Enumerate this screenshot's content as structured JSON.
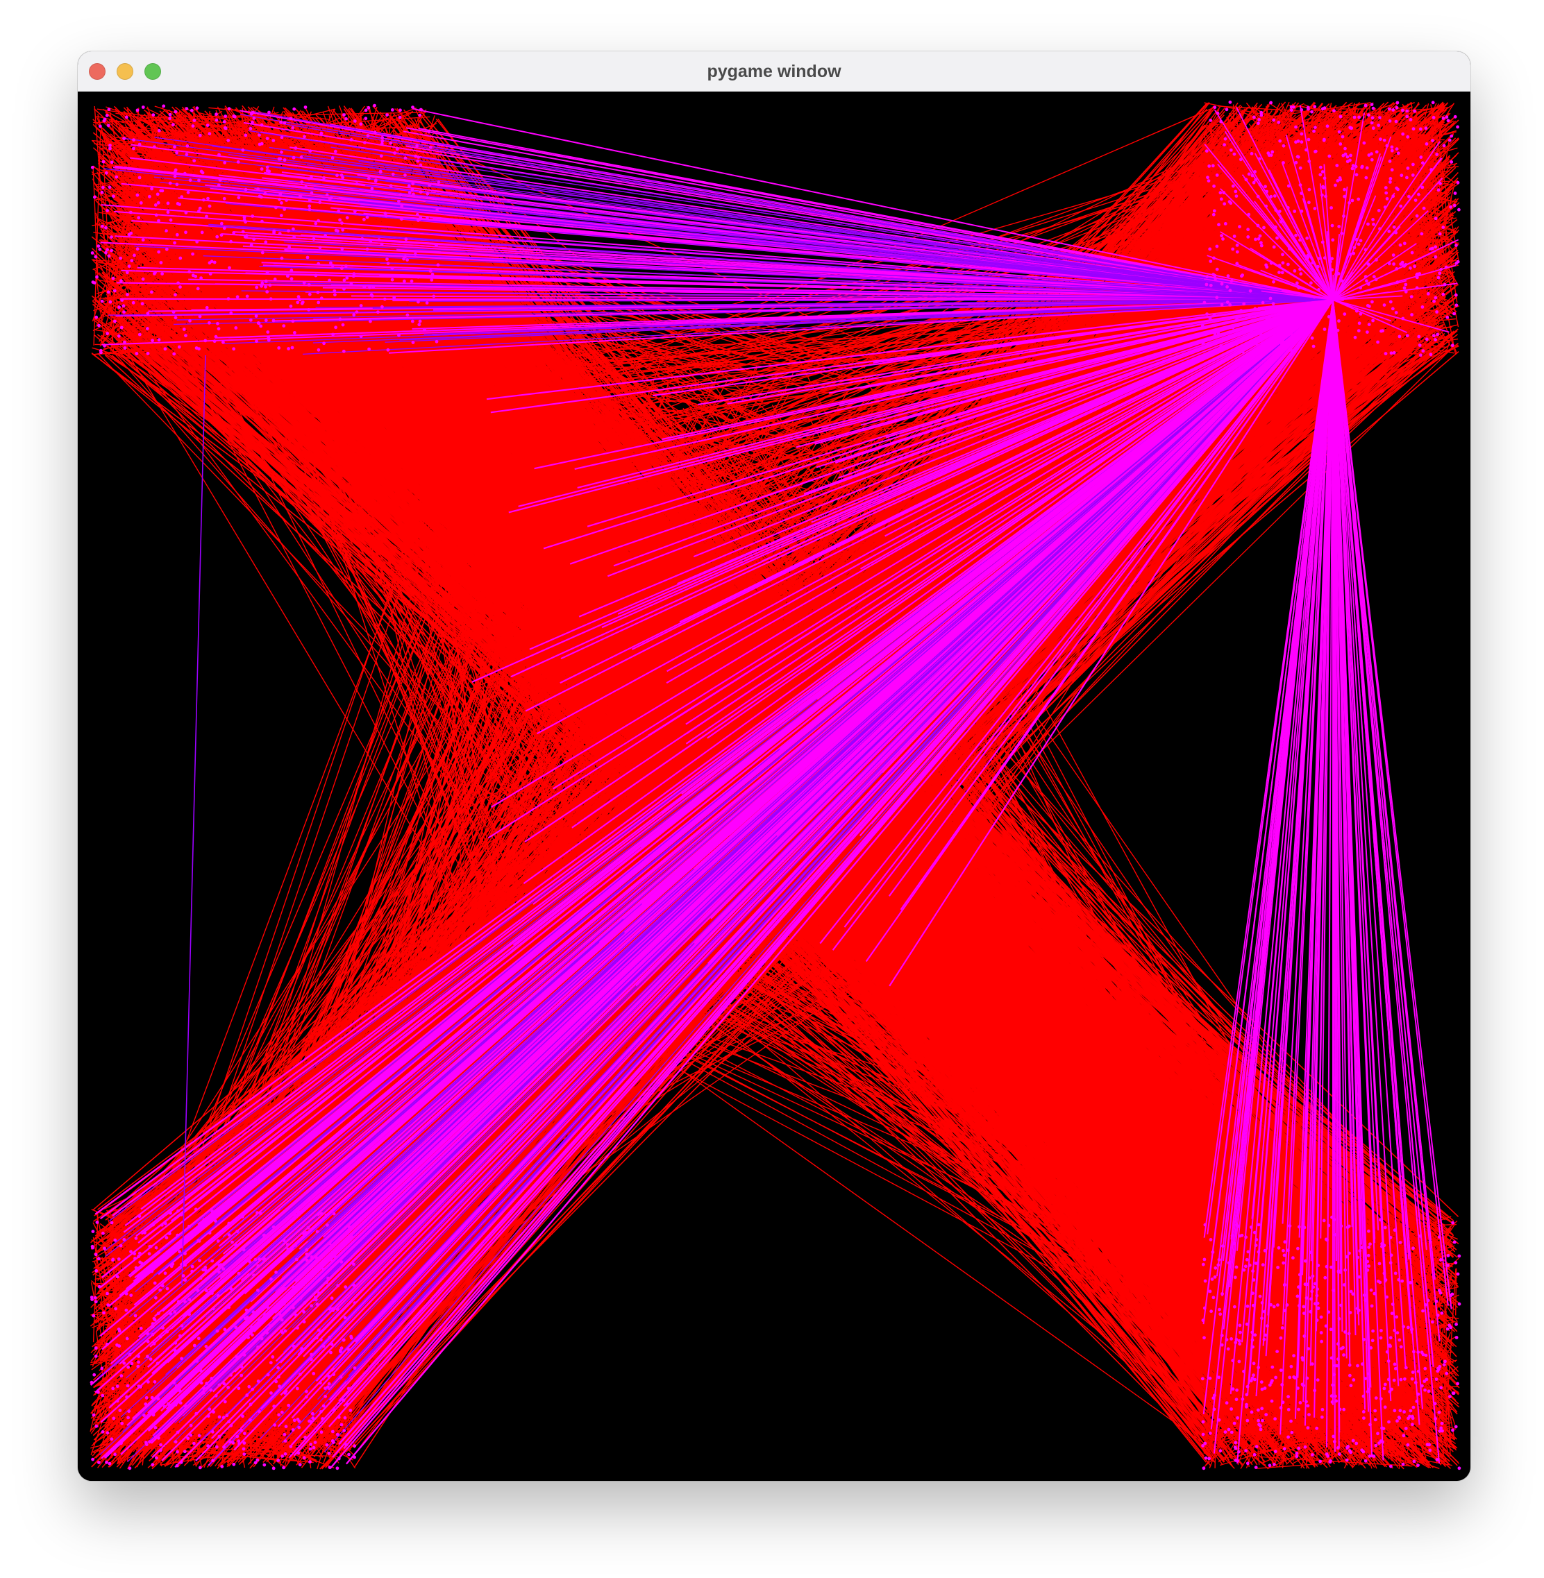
{
  "window": {
    "title": "pygame window",
    "controls": {
      "close_color": "#ed6a5e",
      "minimize_color": "#f5bf4f",
      "maximize_color": "#61c554"
    }
  },
  "canvas": {
    "background_color": "#000000",
    "colors": {
      "edge_primary": "#ff0000",
      "edge_secondary": "#ff00ff",
      "edge_tertiary": "#9b00ff",
      "node_color": "#ff00ff"
    }
  }
}
